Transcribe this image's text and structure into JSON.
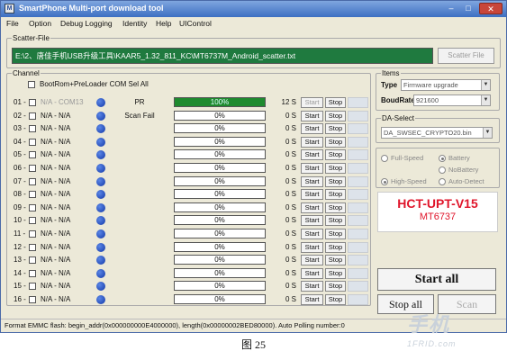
{
  "titlebar": {
    "app_icon": "M",
    "title": "SmartPhone Multi-port download tool",
    "minimize": "–",
    "maximize": "□",
    "close": "✕"
  },
  "menu": [
    "File",
    "Option",
    "Debug Logging",
    "Identity",
    "Help",
    "UIControl"
  ],
  "scatter": {
    "group_label": "Scatter-File",
    "path": "E:\\2、唐佳手机USB升级工具\\KAAR5_1.32_811_KC\\MT6737M_Android_scatter.txt",
    "button_label": "Scatter File"
  },
  "channel": {
    "group_label": "Channel",
    "bootrom_label": "BootRom+PreLoader COM Sel All",
    "rows": [
      {
        "num": "01 -",
        "port": "N/A - COM13",
        "status": "PR",
        "progress": "100%",
        "time": "12 S"
      },
      {
        "num": "02 -",
        "port": "N/A - N/A",
        "status": "Scan Fail",
        "progress": "0%",
        "time": "0 S"
      },
      {
        "num": "03 -",
        "port": "N/A - N/A",
        "status": "",
        "progress": "0%",
        "time": "0 S"
      },
      {
        "num": "04 -",
        "port": "N/A - N/A",
        "status": "",
        "progress": "0%",
        "time": "0 S"
      },
      {
        "num": "05 -",
        "port": "N/A - N/A",
        "status": "",
        "progress": "0%",
        "time": "0 S"
      },
      {
        "num": "06 -",
        "port": "N/A - N/A",
        "status": "",
        "progress": "0%",
        "time": "0 S"
      },
      {
        "num": "07 -",
        "port": "N/A - N/A",
        "status": "",
        "progress": "0%",
        "time": "0 S"
      },
      {
        "num": "08 -",
        "port": "N/A - N/A",
        "status": "",
        "progress": "0%",
        "time": "0 S"
      },
      {
        "num": "09 -",
        "port": "N/A - N/A",
        "status": "",
        "progress": "0%",
        "time": "0 S"
      },
      {
        "num": "10 -",
        "port": "N/A - N/A",
        "status": "",
        "progress": "0%",
        "time": "0 S"
      },
      {
        "num": "11 -",
        "port": "N/A - N/A",
        "status": "",
        "progress": "0%",
        "time": "0 S"
      },
      {
        "num": "12 -",
        "port": "N/A - N/A",
        "status": "",
        "progress": "0%",
        "time": "0 S"
      },
      {
        "num": "13 -",
        "port": "N/A - N/A",
        "status": "",
        "progress": "0%",
        "time": "0 S"
      },
      {
        "num": "14 -",
        "port": "N/A - N/A",
        "status": "",
        "progress": "0%",
        "time": "0 S"
      },
      {
        "num": "15 -",
        "port": "N/A - N/A",
        "status": "",
        "progress": "0%",
        "time": "0 S"
      },
      {
        "num": "16 -",
        "port": "N/A - N/A",
        "status": "",
        "progress": "0%",
        "time": "0 S"
      }
    ],
    "start_label": "Start",
    "stop_label": "Stop"
  },
  "items": {
    "group_label": "Items",
    "type_label": "Type",
    "type_value": "Firmware upgrade",
    "baud_label": "BoudRate",
    "baud_value": "921600"
  },
  "da": {
    "group_label": "DA-Select",
    "value": "DA_SWSEC_CRYPTO20.bin"
  },
  "options": {
    "full_speed": "Full-Speed",
    "high_speed": "High-Speed",
    "battery": "Battery",
    "no_battery": "NoBattery",
    "auto_detect": "Auto-Detect"
  },
  "brand": {
    "line1": "HCT-UPT-V15",
    "line2": "MT6737"
  },
  "actions": {
    "start_all": "Start all",
    "stop_all": "Stop all",
    "scan": "Scan"
  },
  "statusbar": {
    "text": "Format EMMC flash:  begin_addr(0x000000000E4000000), length(0x00000002BED80000). Auto Polling number:0"
  },
  "watermark": {
    "main": "手机",
    "sub": "1FRID.com"
  },
  "caption": "图 25",
  "colors": {
    "progress_done": "#1e8a2e",
    "scatter_bg": "#1f7a3f",
    "brand_red": "#e0162b",
    "led_blue": "#1238a8"
  }
}
